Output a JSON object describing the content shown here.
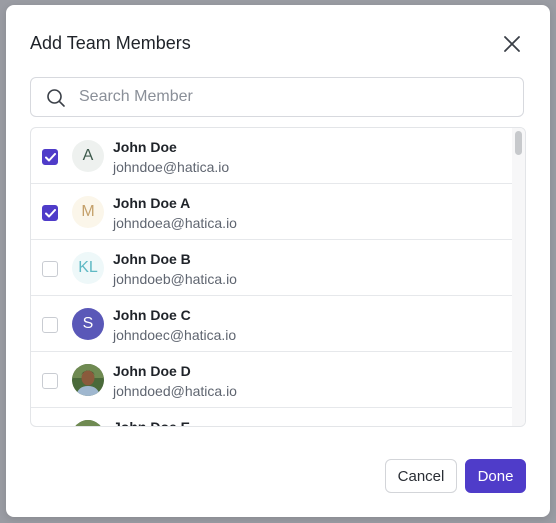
{
  "dialog": {
    "title": "Add Team Members",
    "search": {
      "placeholder": "Search Member",
      "value": ""
    },
    "members": [
      {
        "name": "John Doe",
        "email": "johndoe@hatica.io",
        "checked": true,
        "avatar": {
          "type": "initials",
          "text": "A",
          "bg": "#eef1ef",
          "fg": "#3d5a4c"
        }
      },
      {
        "name": "John Doe A",
        "email": "johndoea@hatica.io",
        "checked": true,
        "avatar": {
          "type": "initials",
          "text": "M",
          "bg": "#fbf6ea",
          "fg": "#c4a06a"
        }
      },
      {
        "name": "John Doe B",
        "email": "johndoeb@hatica.io",
        "checked": false,
        "avatar": {
          "type": "initials",
          "text": "KL",
          "bg": "#eef8f9",
          "fg": "#5fb9c4"
        }
      },
      {
        "name": "John Doe C",
        "email": "johndoec@hatica.io",
        "checked": false,
        "avatar": {
          "type": "initials",
          "text": "S",
          "bg": "#5a58b8",
          "fg": "#ffffff"
        }
      },
      {
        "name": "John Doe D",
        "email": "johndoed@hatica.io",
        "checked": false,
        "avatar": {
          "type": "photo"
        }
      },
      {
        "name": "John Doe E",
        "email": "",
        "checked": false,
        "avatar": {
          "type": "photo"
        }
      }
    ],
    "buttons": {
      "cancel": "Cancel",
      "done": "Done"
    }
  },
  "colors": {
    "accent": "#4f3cc9"
  }
}
